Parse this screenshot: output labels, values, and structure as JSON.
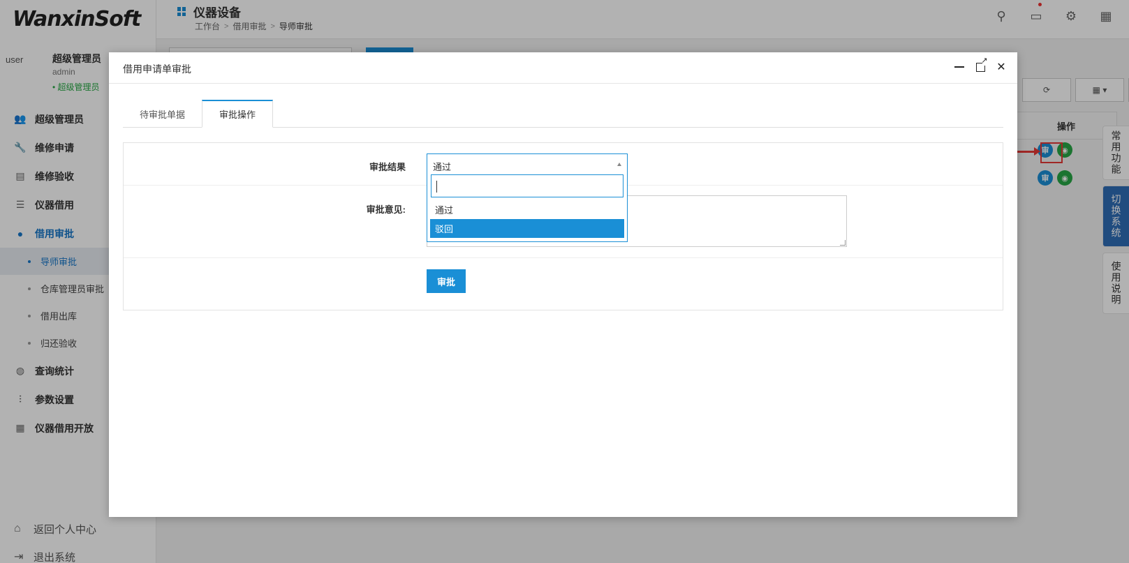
{
  "app": {
    "logo_part1": "Wanxin",
    "logo_part2": "Soft",
    "page_title": "仪器设备",
    "breadcrumb": [
      "工作台",
      "借用审批",
      "导师审批"
    ]
  },
  "user": {
    "avatar_alt": "user",
    "name": "超级管理员",
    "account": "admin",
    "role": "• 超级管理员"
  },
  "sidebar": {
    "items": [
      {
        "label": "超级管理员",
        "icon": "users-icon"
      },
      {
        "label": "维修申请",
        "icon": "wrench-icon"
      },
      {
        "label": "维修验收",
        "icon": "clipboard-icon"
      },
      {
        "label": "仪器借用",
        "icon": "hand-icon"
      },
      {
        "label": "借用审批",
        "icon": "person-icon"
      }
    ],
    "subitems": [
      {
        "label": "导师审批"
      },
      {
        "label": "仓库管理员审批"
      },
      {
        "label": "借用出库"
      },
      {
        "label": "归还验收"
      }
    ],
    "items_after": [
      {
        "label": "查询统计",
        "icon": "search-chart-icon"
      },
      {
        "label": "参数设置",
        "icon": "sliders-icon"
      },
      {
        "label": "仪器借用开放",
        "icon": "store-icon"
      }
    ],
    "footer": [
      {
        "label": "返回个人中心",
        "icon": "home-icon"
      },
      {
        "label": "退出系统",
        "icon": "logout-icon"
      }
    ]
  },
  "table": {
    "action_header": "操作",
    "approve_icon_text": "审"
  },
  "side_tabs": [
    "常用功能",
    "切换系统",
    "使用说明"
  ],
  "modal": {
    "title": "借用申请单审批",
    "tabs": [
      "待审批单据",
      "审批操作"
    ],
    "fields": {
      "result_label": "审批结果",
      "opinion_label": "审批意见:",
      "select_value": "通过",
      "options": [
        "通过",
        "驳回"
      ],
      "submit_label": "审批"
    }
  },
  "colors": {
    "primary": "#1a8fd6",
    "active_nav": "#1777c9",
    "highlight": "#e53935",
    "green": "#28a745"
  }
}
